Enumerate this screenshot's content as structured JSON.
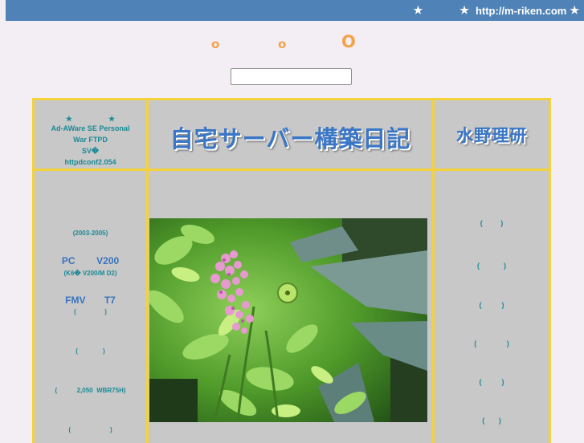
{
  "topbar": {
    "star_left": "★",
    "star_mid": "★",
    "url": "http://m-riken.com",
    "star_right": "★"
  },
  "tagline": {
    "c1": "o",
    "c2": "o",
    "c3": "O"
  },
  "search": {
    "value": "",
    "placeholder": ""
  },
  "left_header": {
    "stars": "★　　　　　★",
    "line1": "Ad-AWare SE Personal",
    "line2": "War  FTPD",
    "line3": "SV�",
    "line4": "httpdconf2.054"
  },
  "banner": {
    "title": "自宅サーバー構築日記"
  },
  "right_header": {
    "logo": "水野理研"
  },
  "left_menu": {
    "range": "(2003-2005)",
    "pc_label": "PC        V200",
    "pc_sub": "(K6�  V200/M  D2)",
    "fmv_label": "FMV       T7",
    "fmv_sub": "(                )",
    "item4": "(              )",
    "item5": "(           2,050  WBR75H)",
    "item6": "(                      )"
  },
  "right_menu": {
    "items": [
      "(         )",
      "(            )",
      "(          )",
      "(               )",
      "(          )",
      "(       )"
    ]
  },
  "colors": {
    "topbar": "#4f83b8",
    "page_bg": "#f3eef3",
    "grid_border": "#f4d23a",
    "cell_bg": "#c8c8c8",
    "accent_text": "#1a8a96",
    "link_blue": "#3874c0",
    "tagline_orange": "#f4a24a"
  }
}
